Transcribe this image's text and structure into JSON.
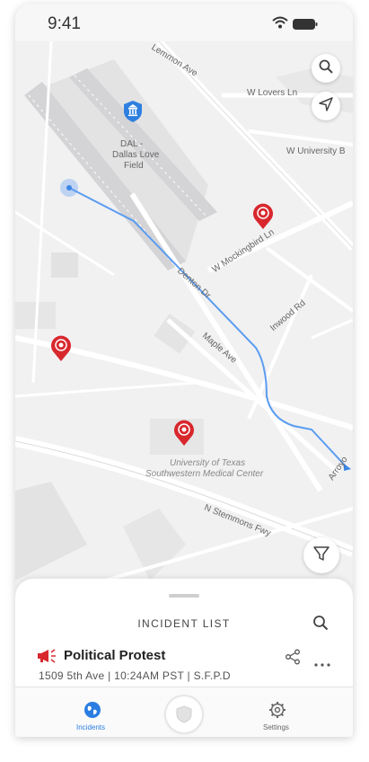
{
  "status_bar": {
    "time": "9:41"
  },
  "map": {
    "labels": {
      "lemmon_ave": "Lemmon Ave",
      "w_lovers_ln": "W Lovers Ln",
      "w_university": "W University B",
      "airport_line1": "DAL -",
      "airport_line2": "Dallas Love",
      "airport_line3": "Field",
      "w_mockingbird": "W Mockingbird Ln",
      "inwood_rd": "Inwood Rd",
      "denton_dr": "Denton Dr",
      "maple_ave": "Maple Ave",
      "utsw_line1": "University of Texas",
      "utsw_line2": "Southwestern Medical Center",
      "n_stemmons": "N Stemmons Fwy",
      "arroyo": "Arroyo"
    },
    "colors": {
      "route": "#5b9cf0",
      "pin": "#d8282e",
      "airport_pin": "#2f7fe0"
    },
    "icons": {
      "search": "search-icon",
      "locate": "navigation-arrow-icon",
      "filter": "filter-icon"
    }
  },
  "incident_list": {
    "title": "INCIDENT LIST",
    "items": [
      {
        "title": "Political Protest",
        "meta": "1509 5th Ave | 10:24AM PST | S.F.P.D"
      }
    ]
  },
  "tabs": [
    {
      "label": "Incidents",
      "icon": "globe-icon",
      "active": true
    },
    {
      "label": "",
      "icon": "shield-icon",
      "active": false
    },
    {
      "label": "Settings",
      "icon": "gear-icon",
      "active": false
    }
  ],
  "accent_color": "#2a7de1"
}
